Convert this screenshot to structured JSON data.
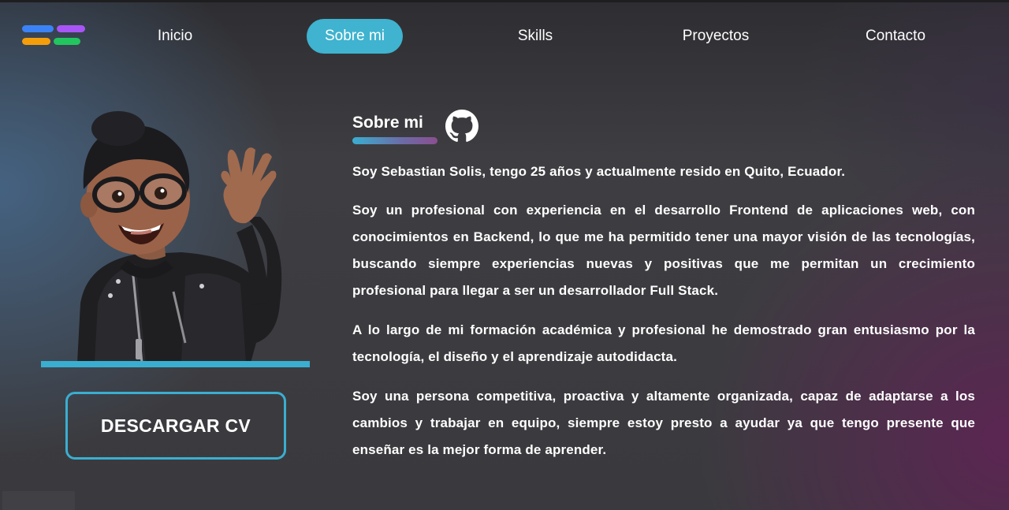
{
  "nav": {
    "items": [
      {
        "label": "Inicio",
        "active": false
      },
      {
        "label": "Sobre mi",
        "active": true
      },
      {
        "label": "Skills",
        "active": false
      },
      {
        "label": "Proyectos",
        "active": false
      },
      {
        "label": "Contacto",
        "active": false
      }
    ],
    "active_color": "#3fb3cf",
    "logo_colors": [
      "#3b82f6",
      "#a855f7",
      "#f59e0b",
      "#22c55e"
    ]
  },
  "profile": {
    "avatar_icon": "memoji-waving-icon",
    "download_button_label": "DESCARGAR CV",
    "accent_color": "#3aaed0"
  },
  "about": {
    "title": "Sobre mi",
    "github_icon": "github-icon",
    "paragraphs": [
      "Soy Sebastian Solis, tengo 25 años y actualmente resido en Quito, Ecuador.",
      "Soy un profesional con experiencia en el desarrollo Frontend de aplicaciones web, con conocimientos en Backend, lo que me ha permitido tener una mayor visión de las tecnologías, buscando siempre experiencias nuevas y positivas que me permitan un crecimiento profesional para llegar a ser un desarrollador Full Stack.",
      "A lo largo de mi formación académica y profesional he demostrado gran entusiasmo por la tecnología, el diseño y el aprendizaje autodidacta.",
      "Soy una persona competitiva, proactiva y altamente organizada, capaz de adaptarse a los cambios y trabajar en equipo, siempre estoy presto a ayudar ya que tengo presente que enseñar es la mejor forma de aprender."
    ]
  }
}
